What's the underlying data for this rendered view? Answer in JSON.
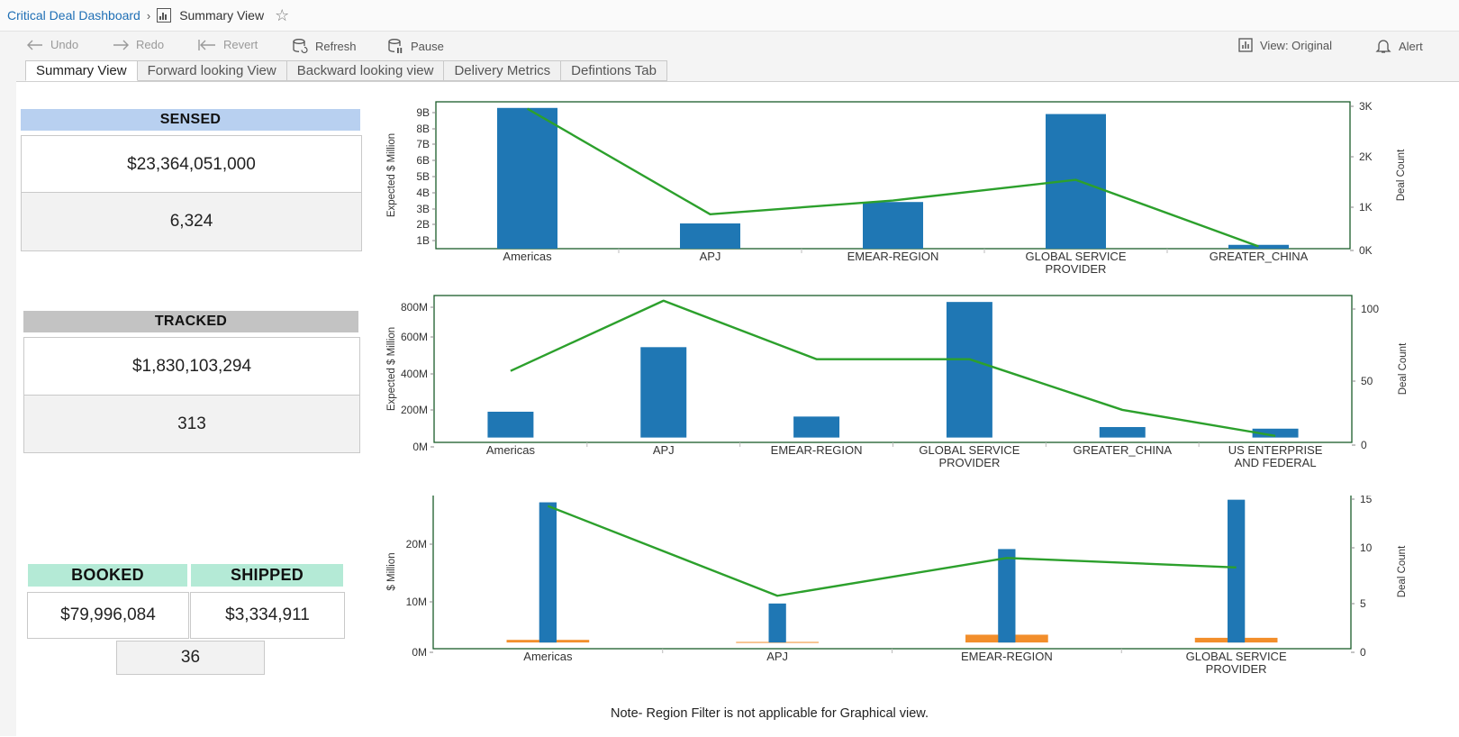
{
  "breadcrumb": {
    "dashboard": "Critical Deal Dashboard",
    "separator": "›",
    "current": "Summary View",
    "icon": "bar-chart-icon",
    "favorite_icon": "star-icon"
  },
  "toolbar": {
    "undo": "Undo",
    "redo": "Redo",
    "revert": "Revert",
    "refresh": "Refresh",
    "pause": "Pause",
    "view": "View: Original",
    "alert": "Alert"
  },
  "tabs": [
    {
      "label": "Summary View",
      "active": true
    },
    {
      "label": "Forward looking View",
      "active": false
    },
    {
      "label": "Backward looking view",
      "active": false
    },
    {
      "label": "Delivery Metrics",
      "active": false
    },
    {
      "label": "Defintions Tab",
      "active": false
    }
  ],
  "kpis": {
    "sensed": {
      "title": "SENSED",
      "amount": "$23,364,051,000",
      "count": "6,324",
      "color": "#b8d0f0"
    },
    "tracked": {
      "title": "TRACKED",
      "amount": "$1,830,103,294",
      "count": "313",
      "color": "#c3c3c3"
    },
    "booked": {
      "title": "BOOKED",
      "amount": "$79,996,084",
      "color": "#b4ead6"
    },
    "shipped": {
      "title": "SHIPPED",
      "amount": "$3,334,911",
      "color": "#b4ead6"
    },
    "booked_count": "36"
  },
  "note": "Note-  Region Filter is not applicable for Graphical view.",
  "colors": {
    "bar": "#1f77b4",
    "line": "#2ca02c",
    "orange": "#f28e2b",
    "frame": "#1a5c2a"
  },
  "chart_data": [
    {
      "type": "bar",
      "categories": [
        "Americas",
        "APJ",
        "EMEAR-REGION",
        "GLOBAL SERVICE PROVIDER",
        "GREATER_CHINA"
      ],
      "series": [
        {
          "name": "",
          "axis": "left",
          "values": [
            9.2,
            1.65,
            3.05,
            8.8,
            0.25
          ]
        },
        {
          "name": "",
          "axis": "right",
          "type": "line",
          "values": [
            3000,
            700,
            1000,
            1450,
            0
          ]
        }
      ],
      "ylabel": "Expected $ Million",
      "ylabel_right": "Deal Count",
      "yticks": [
        "1B",
        "2B",
        "3B",
        "4B",
        "5B",
        "6B",
        "7B",
        "8B",
        "9B"
      ],
      "yticks_right": [
        "0K",
        "1K",
        "2K",
        "3K"
      ],
      "ylim": [
        0,
        9.6
      ],
      "ylim_right": [
        -50,
        3150
      ]
    },
    {
      "type": "bar",
      "categories": [
        "Americas",
        "APJ",
        "EMEAR-REGION",
        "GLOBAL SERVICE PROVIDER",
        "GREATER_CHINA",
        "US ENTERPRISE AND FEDERAL"
      ],
      "series": [
        {
          "name": "",
          "axis": "left",
          "values": [
            160,
            560,
            130,
            840,
            65,
            55
          ]
        },
        {
          "name": "",
          "axis": "right",
          "type": "line",
          "values": [
            50,
            104,
            59,
            59,
            20,
            0
          ]
        }
      ],
      "ylabel": "Expected $ Million",
      "ylabel_right": "Deal Count",
      "yticks": [
        "0M",
        "200M",
        "400M",
        "600M",
        "800M"
      ],
      "yticks_right": [
        "0",
        "50",
        "100"
      ],
      "ylim": [
        -30,
        880
      ],
      "ylim_right": [
        -5,
        108
      ]
    },
    {
      "type": "bar",
      "categories": [
        "Americas",
        "APJ",
        "EMEAR-REGION",
        "GLOBAL SERVICE PROVIDER"
      ],
      "series": [
        {
          "name": "",
          "axis": "left",
          "color": "blue",
          "values": [
            27,
            7.5,
            18,
            27.5
          ]
        },
        {
          "name": "",
          "axis": "left",
          "color": "orange",
          "values": [
            0.5,
            0.1,
            1.5,
            0.9
          ]
        },
        {
          "name": "",
          "axis": "right",
          "type": "line",
          "values": [
            14.5,
            5,
            9,
            8
          ]
        }
      ],
      "ylabel": "$ Million",
      "ylabel_right": "Deal Count",
      "yticks": [
        "0M",
        "10M",
        "20M"
      ],
      "yticks_right": [
        "0",
        "5",
        "10",
        "15"
      ],
      "ylim": [
        -1.2,
        28.5
      ],
      "ylim_right": [
        -0.6,
        15.7
      ]
    }
  ]
}
